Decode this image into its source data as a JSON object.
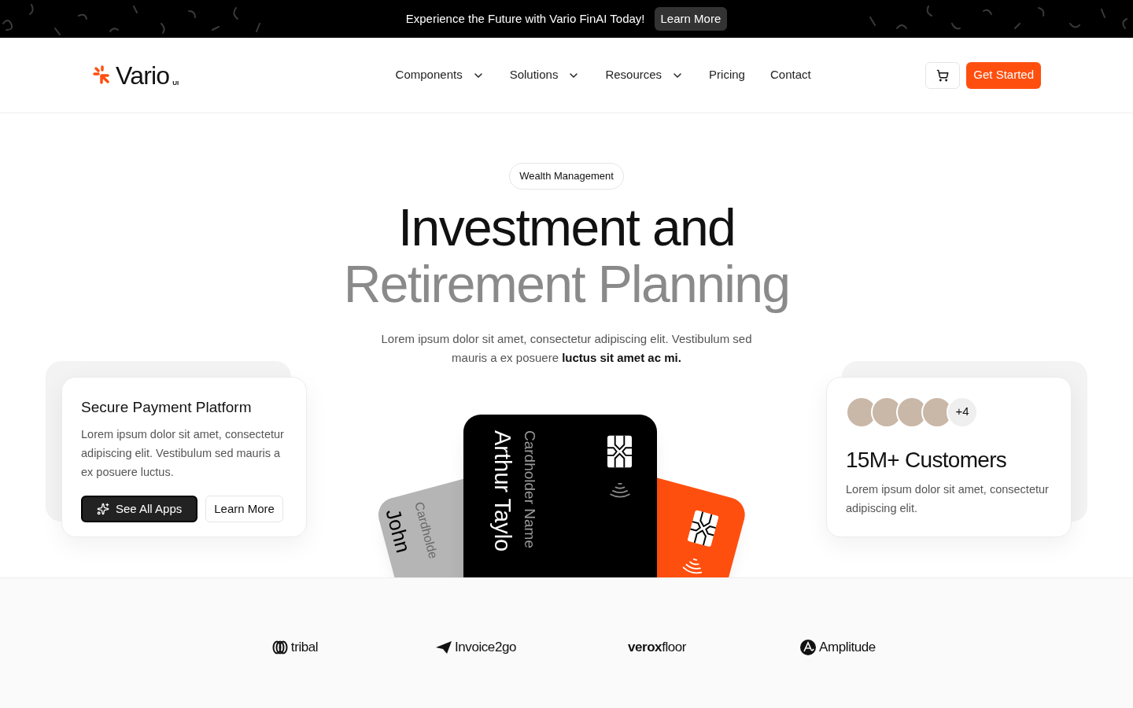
{
  "announcement": {
    "text": "Experience the Future with Vario FinAI Today!",
    "link": "Learn More"
  },
  "nav": {
    "logo": "Vario",
    "logo_badge": "UI",
    "items": [
      {
        "label": "Components",
        "kind": "dropdown"
      },
      {
        "label": "Solutions",
        "kind": "dropdown"
      },
      {
        "label": "Resources",
        "kind": "dropdown"
      },
      {
        "label": "Pricing",
        "kind": "link"
      },
      {
        "label": "Contact",
        "kind": "link"
      }
    ],
    "cta": "Get Started"
  },
  "hero": {
    "badge": "Wealth Management",
    "title_line_1": "Investment and",
    "title_line_2": "Retirement Planning",
    "description": "Lorem ipsum dolor sit amet, consectetur adipiscing elit. Vestibulum sed mauris a ex posuere **luctus sit amet ac mi.**"
  },
  "feature_card": {
    "title": "Secure Payment Platform",
    "text": "Lorem ipsum dolor sit amet, consectetur adipiscing elit. Vestibulum sed mauris a ex posuere luctus.",
    "buttons": [
      {
        "label": "See All Apps",
        "kind": "primary"
      },
      {
        "label": "Learn More",
        "kind": "secondary"
      }
    ]
  },
  "payment_cards": [
    {
      "kind": "gray",
      "label": "Cardholde",
      "name": "John"
    },
    {
      "kind": "black",
      "label": "Cardholder Name",
      "name": "Arthur Taylo"
    },
    {
      "kind": "orange"
    }
  ],
  "customers": {
    "more": "+4",
    "title": "15M+ Customers",
    "text": "Lorem ipsum dolor sit amet, consectetur adipiscing elit."
  },
  "logos": [
    {
      "name": "tribal",
      "kind": "rings"
    },
    {
      "name": "Invoice2go",
      "kind": "plane"
    },
    {
      "name": "**verox**floor",
      "kind": "none"
    },
    {
      "name": "Amplitude",
      "kind": "circle"
    }
  ]
}
